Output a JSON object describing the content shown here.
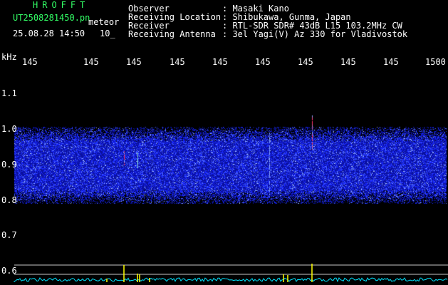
{
  "header": {
    "title": "HROFFT",
    "filename": "UT2508281450.pn",
    "mode": "meteor",
    "datetime": "25.08.28 14:50",
    "interval": "10_",
    "fields": [
      {
        "label": "Observer",
        "value": ": Masaki Kano"
      },
      {
        "label": "Receiving Location",
        "value": ": Shibukawa, Gunma, Japan"
      },
      {
        "label": "Receiver",
        "value": ": RTL-SDR SDR# 43dB L15 103.2MHz CW"
      },
      {
        "label": "Receiving Antenna",
        "value": ": 3el Yagi(V) Az 330 for Vladivostok"
      }
    ]
  },
  "axes": {
    "unit": "kHz",
    "y_ticks": [
      "1.1",
      "1.0",
      "0.9",
      "0.8",
      "0.7",
      "0.6"
    ],
    "x_ticks": [
      "145",
      "145",
      "145",
      "145",
      "145",
      "145",
      "145",
      "145",
      "145",
      "1500"
    ]
  },
  "colors": {
    "background": "#000000",
    "header_green": "#33ff66",
    "tick_yellow": "#ffff00",
    "waterfall_blue": "#1a2aff",
    "spectrum_cyan": "#00e5ff",
    "grid_white": "#c8c8c8"
  }
}
